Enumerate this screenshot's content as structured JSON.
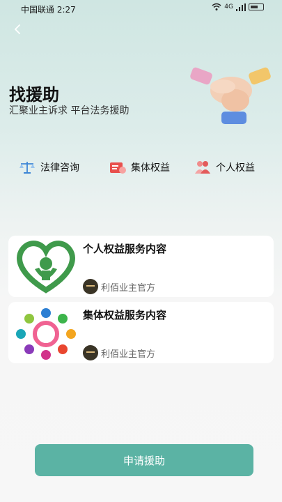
{
  "status": {
    "carrier_time": "中国联通 2:27",
    "network_label": "4G"
  },
  "header": {
    "title": "找援助",
    "subtitle": "汇聚业主诉求 平台法务援助"
  },
  "categories": [
    {
      "label": "法律咨询",
      "icon": "scale-icon"
    },
    {
      "label": "集体权益",
      "icon": "document-icon"
    },
    {
      "label": "个人权益",
      "icon": "people-icon"
    }
  ],
  "cards": [
    {
      "title": "个人权益服务内容",
      "author": "利佰业主官方",
      "thumb": "heart-person-logo"
    },
    {
      "title": "集体权益服务内容",
      "author": "利佰业主官方",
      "thumb": "circle-of-people-logo"
    }
  ],
  "footer": {
    "apply_label": "申请援助"
  },
  "colors": {
    "accent": "#5bb3a4",
    "logo_green": "#3f9a4b"
  }
}
